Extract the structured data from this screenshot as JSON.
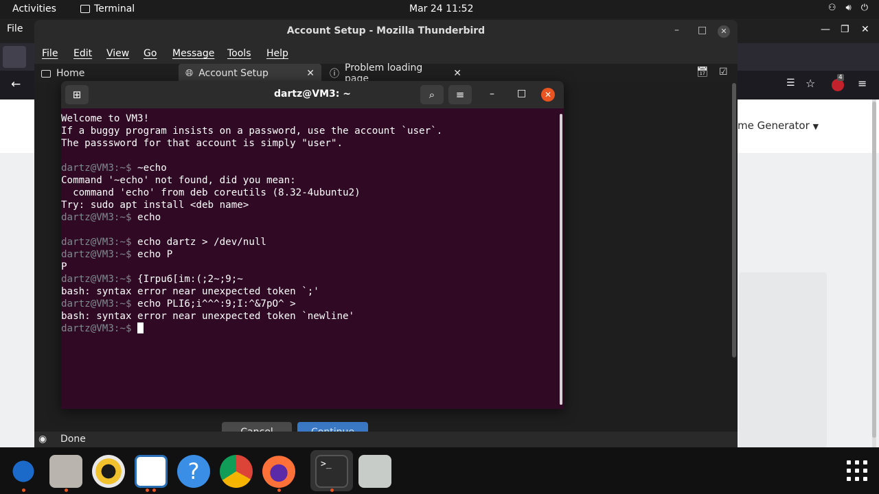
{
  "topbar": {
    "activities": "Activities",
    "app_name": "Terminal",
    "clock": "Mar 24  11:52"
  },
  "firefox": {
    "menu_file": "File",
    "generator_label": "me Generator",
    "extensions_badge": "4"
  },
  "thunderbird": {
    "title": "Account Setup - Mozilla Thunderbird",
    "menu": [
      "File",
      "Edit",
      "View",
      "Go",
      "Message",
      "Tools",
      "Help"
    ],
    "tabs": [
      {
        "label": "Home"
      },
      {
        "label": "Account Setup"
      },
      {
        "label": "Problem loading page"
      }
    ],
    "buttons": {
      "cancel": "Cancel",
      "continue": "Continue"
    },
    "status": "Done"
  },
  "terminal": {
    "title": "dartz@VM3: ~",
    "prompt": "dartz@VM3:~$ ",
    "lines": [
      {
        "text": "Welcome to VM3!"
      },
      {
        "text": "If a buggy program insists on a password, use the account `user`."
      },
      {
        "text": "The passsword for that account is simply \"user\"."
      },
      {
        "text": ""
      },
      {
        "prompt": true,
        "text": "~echo"
      },
      {
        "text": "Command '~echo' not found, did you mean:"
      },
      {
        "text": "  command 'echo' from deb coreutils (8.32-4ubuntu2)"
      },
      {
        "text": "Try: sudo apt install <deb name>"
      },
      {
        "prompt": true,
        "text": "echo"
      },
      {
        "text": ""
      },
      {
        "prompt": true,
        "text": "echo dartz > /dev/null"
      },
      {
        "prompt": true,
        "text": "echo P"
      },
      {
        "text": "P"
      },
      {
        "prompt": true,
        "text": "{Irpu6[im:(;2~;9;~"
      },
      {
        "text": "bash: syntax error near unexpected token `;'"
      },
      {
        "prompt": true,
        "text": "echo PLI6;i^^^:9;I:^&7pO^ >"
      },
      {
        "text": "bash: syntax error near unexpected token `newline'"
      },
      {
        "prompt": true,
        "text": "",
        "cursor": true
      }
    ]
  },
  "dock": {
    "items": [
      "thunderbird",
      "files",
      "rhythmbox",
      "writer",
      "help",
      "chrome",
      "firefox",
      "terminal",
      "trash"
    ]
  },
  "colors": {
    "terminal_bg": "#300a24",
    "accent": "#e95420"
  }
}
